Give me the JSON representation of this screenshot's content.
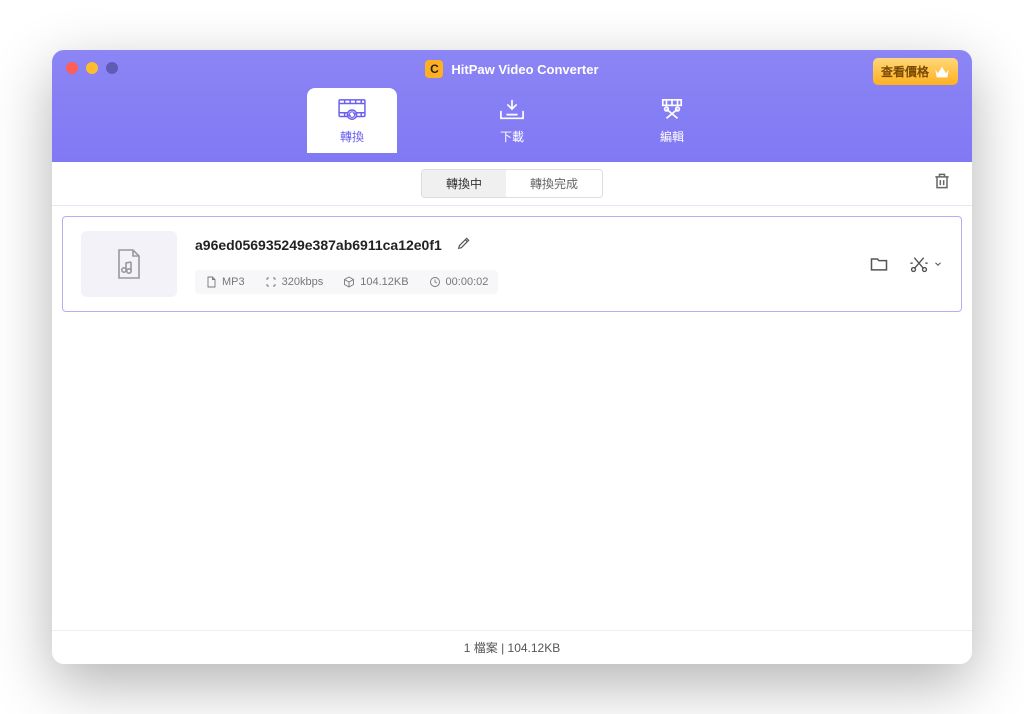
{
  "app": {
    "title": "HitPaw Video Converter",
    "logo_letter": "C"
  },
  "price_button": {
    "label": "查看價格"
  },
  "nav": {
    "convert": "轉換",
    "download": "下載",
    "edit": "編輯"
  },
  "status_tabs": {
    "converting": "轉換中",
    "completed": "轉換完成"
  },
  "file": {
    "name": "a96ed056935249e387ab6911ca12e0f1",
    "format": "MP3",
    "bitrate": "320kbps",
    "size": "104.12KB",
    "duration": "00:00:02"
  },
  "footer": {
    "text": "1 檔案 | 104.12KB"
  }
}
